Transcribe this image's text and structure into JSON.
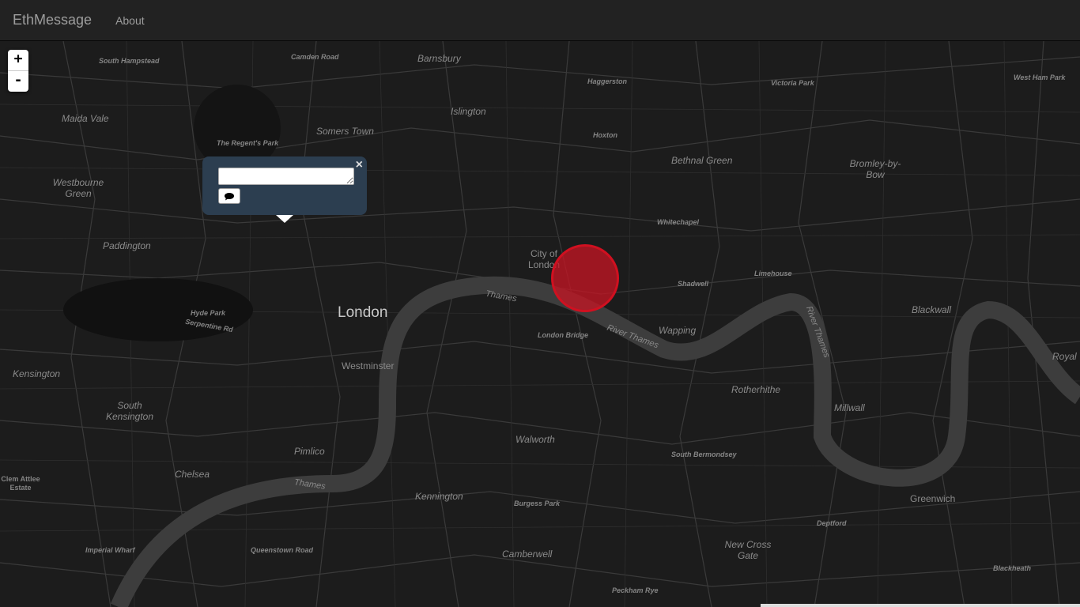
{
  "navbar": {
    "brand": "EthMessage",
    "about": "About"
  },
  "zoom": {
    "in": "+",
    "out": "-"
  },
  "popup": {
    "close": "×",
    "message_value": "",
    "send_icon": "speech-bubble-icon"
  },
  "marker": {
    "color": "#c81423"
  },
  "map_labels": {
    "south_hampstead": "South Hampstead",
    "camden_road": "Camden Road",
    "barnsbury": "Barnsbury",
    "haggerston": "Haggerston",
    "victoria_park": "Victoria Park",
    "west_ham_park": "West Ham Park",
    "maida_vale": "Maida Vale",
    "islington": "Islington",
    "somers_town": "Somers Town",
    "the_regents_park": "The Regent's Park",
    "hoxton": "Hoxton",
    "bethnal_green": "Bethnal Green",
    "bromley_by_bow": "Bromley-by-Bow",
    "westbourne_green": "Westbourne Green",
    "whitechapel": "Whitechapel",
    "paddington": "Paddington",
    "city_of_london": "City of London",
    "shadwell": "Shadwell",
    "limehouse": "Limehouse",
    "london": "London",
    "thames_1": "Thames",
    "hyde_park": "Hyde Park",
    "serpentine_rd": "Serpentine Rd",
    "london_bridge": "London Bridge",
    "river_thames_1": "River Thames",
    "wapping": "Wapping",
    "blackwall": "Blackwall",
    "river_thames_2": "River Thames",
    "kensington": "Kensington",
    "westminster": "Westminster",
    "rotherhithe": "Rotherhithe",
    "royal": "Royal",
    "south_kensington": "South Kensington",
    "millwall": "Millwall",
    "walworth": "Walworth",
    "pimlico": "Pimlico",
    "south_bermondsey": "South Bermondsey",
    "chelsea": "Chelsea",
    "clem_attlee_estate": "Clem Attlee Estate",
    "thames_2": "Thames",
    "kennington": "Kennington",
    "burgess_park": "Burgess Park",
    "greenwich": "Greenwich",
    "deptford": "Deptford",
    "imperial_wharf": "Imperial Wharf",
    "queenstown_road": "Queenstown Road",
    "camberwell": "Camberwell",
    "new_cross_gate": "New Cross Gate",
    "blackheath": "Blackheath",
    "peckham_rye": "Peckham Rye"
  }
}
